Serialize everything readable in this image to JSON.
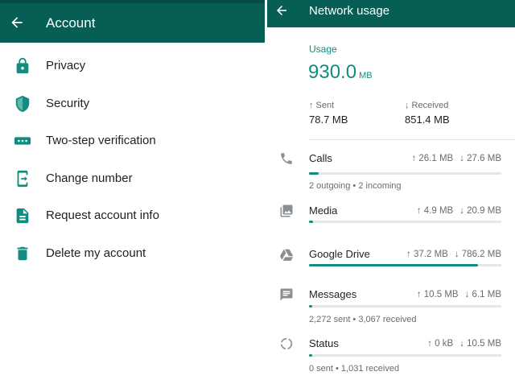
{
  "account": {
    "title": "Account",
    "items": [
      {
        "label": "Privacy",
        "icon": "lock-icon"
      },
      {
        "label": "Security",
        "icon": "shield-icon"
      },
      {
        "label": "Two-step verification",
        "icon": "dots-icon"
      },
      {
        "label": "Change number",
        "icon": "phone-change-icon"
      },
      {
        "label": "Request account info",
        "icon": "document-icon"
      },
      {
        "label": "Delete my account",
        "icon": "trash-icon"
      }
    ]
  },
  "network": {
    "title": "Network usage",
    "usage_label": "Usage",
    "total_value": "930.0",
    "total_unit": "MB",
    "sent_label": "↑ Sent",
    "sent_value": "78.7 MB",
    "received_label": "↓ Received",
    "received_value": "851.4 MB",
    "categories": [
      {
        "name": "Calls",
        "sent": "↑ 26.1 MB",
        "received": "↓ 27.6 MB",
        "sub": "2 outgoing • 2 incoming",
        "fill": 0.05,
        "icon": "phone-icon"
      },
      {
        "name": "Media",
        "sent": "↑ 4.9 MB",
        "received": "↓ 20.9 MB",
        "sub": "",
        "fill": 0.02,
        "icon": "photo-icon"
      },
      {
        "name": "Google Drive",
        "sent": "↑ 37.2 MB",
        "received": "↓ 786.2 MB",
        "sub": "",
        "fill": 0.88,
        "icon": "google-drive-icon"
      },
      {
        "name": "Messages",
        "sent": "↑ 10.5 MB",
        "received": "↓ 6.1 MB",
        "sub": "2,272 sent • 3,067 received",
        "fill": 0.01,
        "icon": "message-icon"
      },
      {
        "name": "Status",
        "sent": "↑ 0 kB",
        "received": "↓ 10.5 MB",
        "sub": "0 sent • 1,031 received",
        "fill": 0.01,
        "icon": "status-icon"
      }
    ]
  },
  "colors": {
    "header": "#075e54",
    "accent": "#128c7e",
    "icon_gray": "#8a8f93"
  }
}
